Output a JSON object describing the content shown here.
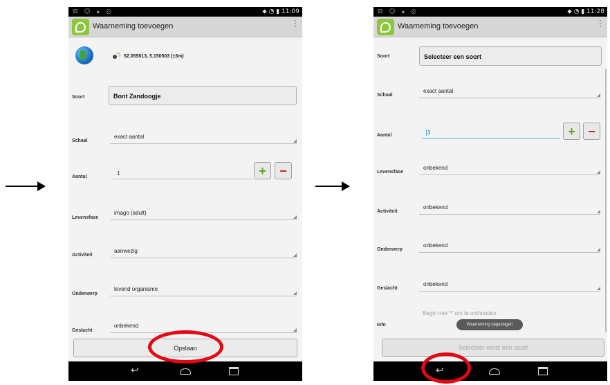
{
  "left": {
    "status_time": "11:09",
    "app_title": "Waarneming toevoegen",
    "coordinates": "52.055613, 5.150503  (±3m)",
    "species_label": "Soort",
    "species_value": "Bont Zandoogje",
    "fields": [
      {
        "label": "Schaal",
        "value": "exact aantal"
      },
      {
        "label": "Aantal",
        "value": "1"
      },
      {
        "label": "Levensfase",
        "value": "imago (adult)"
      },
      {
        "label": "Activiteit",
        "value": "aanwezig"
      },
      {
        "label": "Onderwerp",
        "value": "levend organisme"
      },
      {
        "label": "Geslacht",
        "value": "onbekend"
      }
    ],
    "save_button": "Opslaan"
  },
  "right": {
    "status_time": "11:28",
    "app_title": "Waarneming toevoegen",
    "species_label": "Soort",
    "species_value": "Selecteer een soort",
    "fields": [
      {
        "label": "Schaal",
        "value": "exact aantal"
      },
      {
        "label": "Aantal",
        "value": "1"
      },
      {
        "label": "Levensfase",
        "value": "onbekend"
      },
      {
        "label": "Activiteit",
        "value": "onbekend"
      },
      {
        "label": "Onderwerp",
        "value": "onbekend"
      },
      {
        "label": "Geslacht",
        "value": "onbekend"
      }
    ],
    "info_label": "Info",
    "info_placeholder": "Begin met '*' om te onthouden",
    "toast": "Waarneming opgeslagen",
    "save_button": "Selecteer eerst een soort"
  },
  "common": {
    "plus_symbol": "+",
    "minus_symbol": "−",
    "menu_symbol": "⋮",
    "back_symbol": "↩",
    "status_left_icons": "⊟ ☺ ▴ ◎",
    "status_right_icons": "⬥ ◔ ▮"
  }
}
